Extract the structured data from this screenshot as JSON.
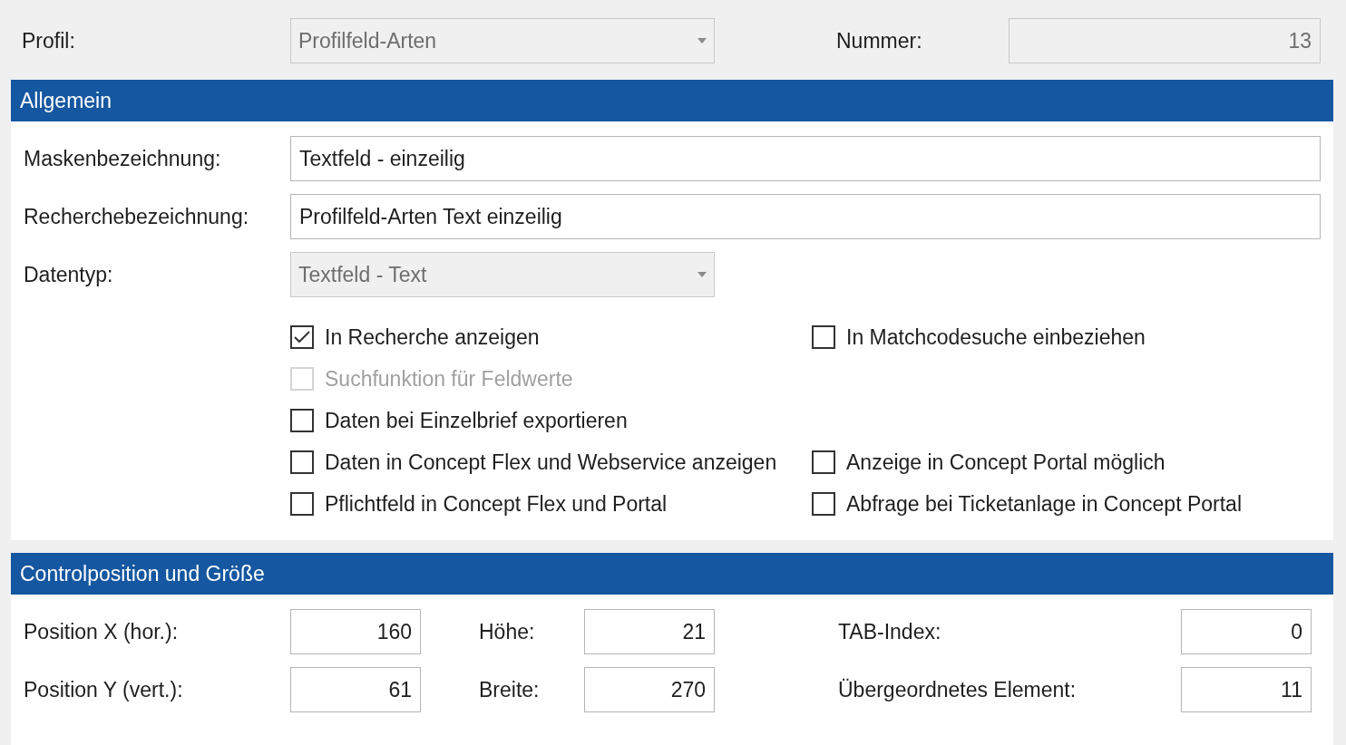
{
  "header": {
    "profil": {
      "label": "Profil:",
      "value": "Profilfeld-Arten",
      "disabled": true
    },
    "nummer": {
      "label": "Nummer:",
      "value": "13",
      "disabled": true
    }
  },
  "allgemein": {
    "title": "Allgemein",
    "fields": [
      {
        "kind": "text",
        "label": "Maskenbezeichnung:",
        "value": "Textfeld - einzeilig",
        "disabled": false
      },
      {
        "kind": "text",
        "label": "Recherchebezeichnung:",
        "value": "Profilfeld-Arten Text einzeilig",
        "disabled": false
      },
      {
        "kind": "combo",
        "label": "Datentyp:",
        "value": "Textfeld - Text",
        "disabled": true
      }
    ],
    "checkbox_rows": [
      {
        "left": {
          "label": "In Recherche anzeigen",
          "checked": true,
          "disabled": false
        },
        "right": {
          "label": "In Matchcodesuche einbeziehen",
          "checked": false,
          "disabled": false
        }
      },
      {
        "left": {
          "label": "Suchfunktion für Feldwerte",
          "checked": false,
          "disabled": true
        }
      },
      {
        "left": {
          "label": "Daten bei Einzelbrief exportieren",
          "checked": false,
          "disabled": false
        }
      },
      {
        "left": {
          "label": "Daten in Concept Flex und Webservice anzeigen",
          "checked": false,
          "disabled": false
        },
        "right": {
          "label": "Anzeige in Concept Portal möglich",
          "checked": false,
          "disabled": false
        }
      },
      {
        "left": {
          "label": "Pflichtfeld in Concept Flex und Portal",
          "checked": false,
          "disabled": false
        },
        "right": {
          "label": "Abfrage bei Ticketanlage in Concept Portal",
          "checked": false,
          "disabled": false
        }
      }
    ]
  },
  "position": {
    "title": "Controlposition und Größe",
    "rows": [
      [
        {
          "label": "Position X (hor.):",
          "value": "160"
        },
        {
          "label": "Höhe:",
          "value": "21"
        },
        {
          "label": "TAB-Index:",
          "value": "0"
        }
      ],
      [
        {
          "label": "Position Y (vert.):",
          "value": "61"
        },
        {
          "label": "Breite:",
          "value": "270"
        },
        {
          "label": "Übergeordnetes Element:",
          "value": "11"
        }
      ]
    ]
  }
}
